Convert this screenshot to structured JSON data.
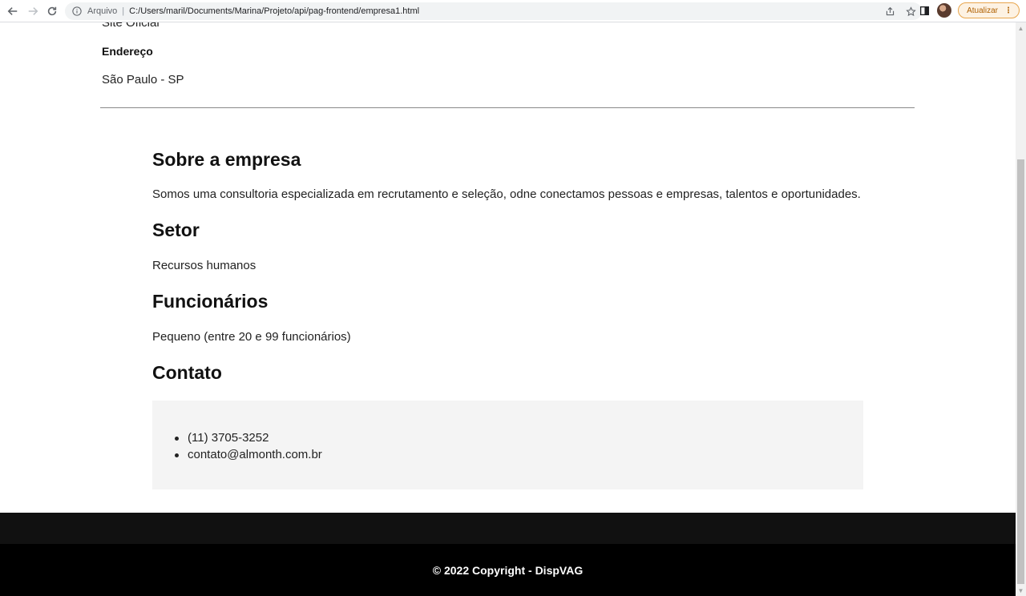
{
  "browser": {
    "scheme_label": "Arquivo",
    "url": "C:/Users/maril/Documents/Marina/Projeto/api/pag-frontend/empresa1.html",
    "update_label": "Atualizar"
  },
  "company": {
    "partial_line": "Site Oficial",
    "address_label": "Endereço",
    "address_value": "São Paulo - SP"
  },
  "about": {
    "title": "Sobre a empresa",
    "text": "Somos uma consultoria especializada em recrutamento e seleção, odne conectamos pessoas e empresas, talentos e oportunidades."
  },
  "sector": {
    "title": "Setor",
    "text": "Recursos humanos"
  },
  "employees": {
    "title": "Funcionários",
    "text": "Pequeno (entre 20 e 99 funcionários)"
  },
  "contact": {
    "title": "Contato",
    "items": [
      "(11) 3705-3252",
      "contato@almonth.com.br"
    ]
  },
  "footer": {
    "text": "© 2022 Copyright - DispVAG"
  },
  "colors": {
    "footer_bg": "#000000",
    "contact_box_bg": "#f4f4f4",
    "update_button": "#fdf2e3"
  }
}
